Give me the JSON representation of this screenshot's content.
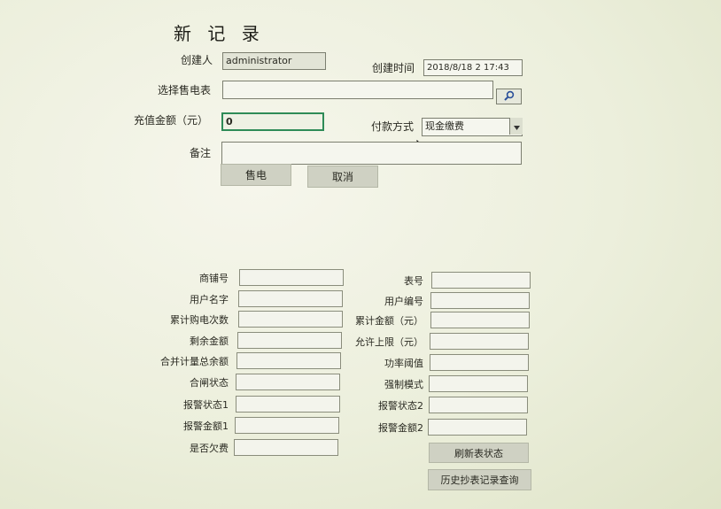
{
  "form": {
    "title": "新 记 录",
    "creator_label": "创建人",
    "creator_value": "administrator",
    "created_time_label": "创建时间",
    "created_time_value": "2018/8/18 2 17:43",
    "select_meter_label": "选择售电表",
    "select_meter_value": "",
    "recharge_label": "充值金额（元）",
    "recharge_value": "0",
    "payment_label": "付款方式",
    "payment_value": "现金缴费",
    "remark_label": "备注",
    "remark_value": "",
    "sell_button": "售电",
    "cancel_button": "取消"
  },
  "details": {
    "left": [
      {
        "label": "商铺号",
        "value": ""
      },
      {
        "label": "用户名字",
        "value": ""
      },
      {
        "label": "累计购电次数",
        "value": ""
      },
      {
        "label": "剩余金额",
        "value": ""
      },
      {
        "label": "合并计量总余额",
        "value": ""
      },
      {
        "label": "合闸状态",
        "value": ""
      },
      {
        "label": "报警状态1",
        "value": ""
      },
      {
        "label": "报警金额1",
        "value": ""
      },
      {
        "label": "是否欠费",
        "value": ""
      }
    ],
    "right": [
      {
        "label": "表号",
        "value": ""
      },
      {
        "label": "用户编号",
        "value": ""
      },
      {
        "label": "累计金额（元）",
        "value": ""
      },
      {
        "label": "允许上限（元）",
        "value": ""
      },
      {
        "label": "功率阈值",
        "value": ""
      },
      {
        "label": "强制模式",
        "value": ""
      },
      {
        "label": "报警状态2",
        "value": ""
      },
      {
        "label": "报警金额2",
        "value": ""
      }
    ],
    "refresh_button": "刷新表状态",
    "history_button": "历史抄表记录查询"
  },
  "icons": {
    "search": "search-icon",
    "dropdown": "chevron-down-icon",
    "cursor": "mouse-cursor-icon"
  }
}
